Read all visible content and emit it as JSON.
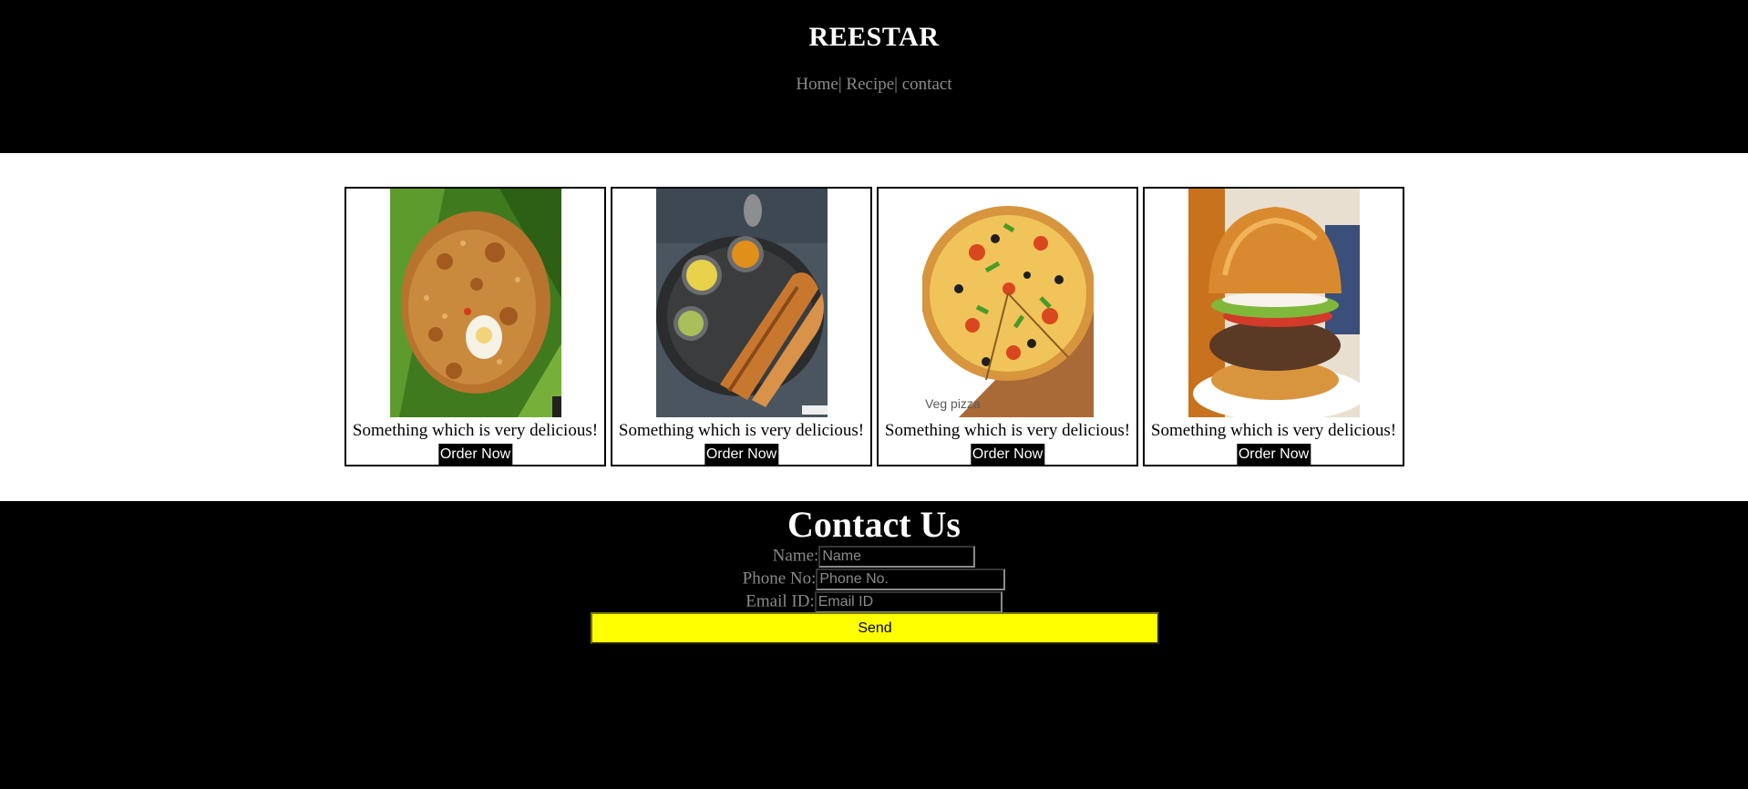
{
  "header": {
    "brand": "REESTAR",
    "nav": [
      {
        "label": "Home"
      },
      {
        "label": "Recipe"
      },
      {
        "label": "contact"
      }
    ],
    "separator": "|"
  },
  "cards": [
    {
      "image": "biryani-image",
      "caption": "Something which is very delicious!",
      "button": "Order Now"
    },
    {
      "image": "dosa-image",
      "caption": "Something which is very delicious!",
      "button": "Order Now"
    },
    {
      "image": "veg-pizza-image",
      "image_text": "Veg pizza",
      "caption": "Something which is very delicious!",
      "button": "Order Now"
    },
    {
      "image": "burger-image",
      "caption": "Something which is very delicious!",
      "button": "Order Now"
    }
  ],
  "contact": {
    "title": "Contact Us",
    "fields": [
      {
        "label": "Name:",
        "placeholder": "Name",
        "value": ""
      },
      {
        "label": "Phone No:",
        "placeholder": "Phone No.",
        "value": ""
      },
      {
        "label": "Email ID:",
        "placeholder": "Email ID",
        "value": ""
      }
    ],
    "send_label": "Send"
  },
  "colors": {
    "header_bg": "#000000",
    "nav_text": "#8a8a8a",
    "send_bg": "#ffff00",
    "order_bg": "#000000"
  }
}
